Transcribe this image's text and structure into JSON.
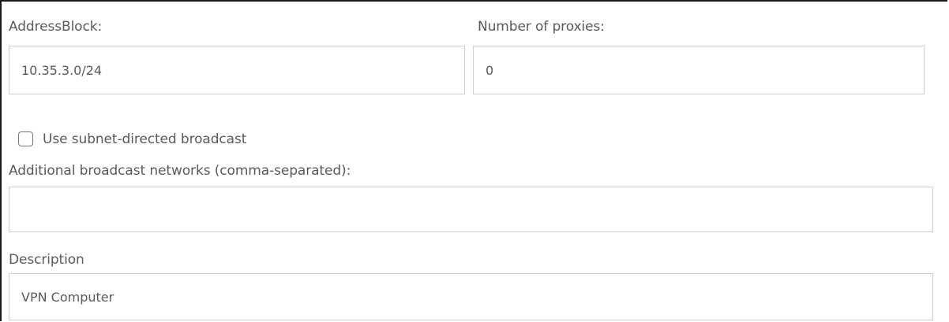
{
  "form": {
    "address_block": {
      "label": "AddressBlock:",
      "value": "10.35.3.0/24"
    },
    "proxies": {
      "label": "Number of proxies:",
      "value": "0"
    },
    "subnet_broadcast": {
      "label": "Use subnet-directed broadcast",
      "checked": false
    },
    "additional_networks": {
      "label": "Additional broadcast networks (comma-separated):",
      "value": ""
    },
    "description": {
      "label": "Description",
      "value": "VPN Computer"
    }
  }
}
